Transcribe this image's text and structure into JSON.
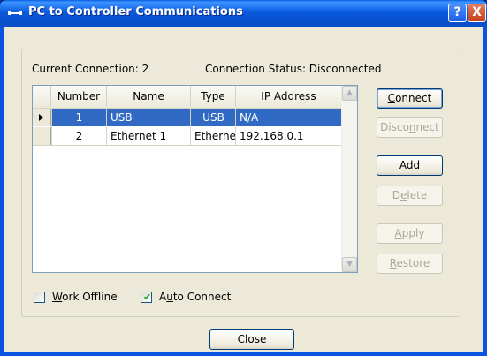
{
  "window": {
    "title": "PC to Controller Communications",
    "help_symbol": "?",
    "close_symbol": "X"
  },
  "status": {
    "current_connection": "Current Connection: 2",
    "connection_status": "Connection Status: Disconnected"
  },
  "table": {
    "columns": [
      "Number",
      "Name",
      "Type",
      "IP Address"
    ],
    "rows": [
      {
        "number": "1",
        "name": "USB",
        "type": "USB",
        "ip": "N/A",
        "selected": true
      },
      {
        "number": "2",
        "name": "Ethernet 1",
        "type": "Ethernet",
        "ip": "192.168.0.1",
        "selected": false
      }
    ]
  },
  "buttons": {
    "connect": {
      "pre": "",
      "mnemonic": "C",
      "post": "onnect",
      "enabled": true
    },
    "disconnect": {
      "pre": "Disco",
      "mnemonic": "n",
      "post": "nect",
      "enabled": false
    },
    "add": {
      "pre": "A",
      "mnemonic": "d",
      "post": "d",
      "enabled": true
    },
    "delete": {
      "pre": "D",
      "mnemonic": "e",
      "post": "lete",
      "enabled": false
    },
    "apply": {
      "pre": "",
      "mnemonic": "A",
      "post": "pply",
      "enabled": false
    },
    "restore": {
      "pre": "",
      "mnemonic": "R",
      "post": "estore",
      "enabled": false
    },
    "close": {
      "label": "Close"
    }
  },
  "options": {
    "work_offline": {
      "pre": "",
      "mnemonic": "W",
      "post": "ork Offline",
      "checked": false
    },
    "auto_connect": {
      "pre": "A",
      "mnemonic": "u",
      "post": "to Connect",
      "checked": true
    }
  },
  "colors": {
    "selection": "#316ac5",
    "titlebar": "#0a5fe0"
  }
}
